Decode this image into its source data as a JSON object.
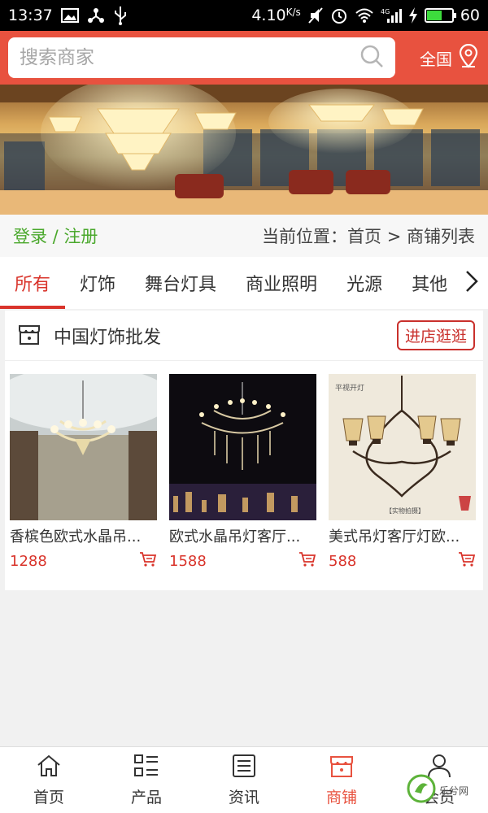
{
  "status_bar": {
    "time": "13:37",
    "speed": "4.10",
    "speed_unit": "K/s",
    "battery": "60"
  },
  "header": {
    "search_placeholder": "搜索商家",
    "region_label": "全国"
  },
  "breadcrumb": {
    "login_label": "登录 / 注册",
    "location_text": "当前位置：首页 > 商铺列表"
  },
  "tabs": [
    {
      "label": "所有",
      "active": true
    },
    {
      "label": "灯饰",
      "active": false
    },
    {
      "label": "舞台灯具",
      "active": false
    },
    {
      "label": "商业照明",
      "active": false
    },
    {
      "label": "光源",
      "active": false
    },
    {
      "label": "其他",
      "active": false
    }
  ],
  "shop": {
    "name": "中国灯饰批发",
    "visit_label": "进店逛逛",
    "products": [
      {
        "name": "香槟色欧式水晶吊...",
        "price": "1288"
      },
      {
        "name": "欧式水晶吊灯客厅...",
        "price": "1588"
      },
      {
        "name": "美式吊灯客厅灯欧...",
        "price": "588",
        "image_caption_top": "平视开灯",
        "image_caption_bottom": "【实物拍摄】"
      }
    ]
  },
  "bottom_nav": [
    {
      "label": "首页",
      "icon": "home-icon",
      "active": false
    },
    {
      "label": "产品",
      "icon": "grid-list-icon",
      "active": false
    },
    {
      "label": "资讯",
      "icon": "news-icon",
      "active": false
    },
    {
      "label": "商铺",
      "icon": "shop-icon",
      "active": true
    },
    {
      "label": "会员",
      "icon": "user-icon",
      "active": false
    }
  ],
  "watermark": {
    "text": "乐兮网"
  },
  "colors": {
    "brand": "#e8523f",
    "accent_red": "#d9342b",
    "login_green": "#4aa82c"
  }
}
